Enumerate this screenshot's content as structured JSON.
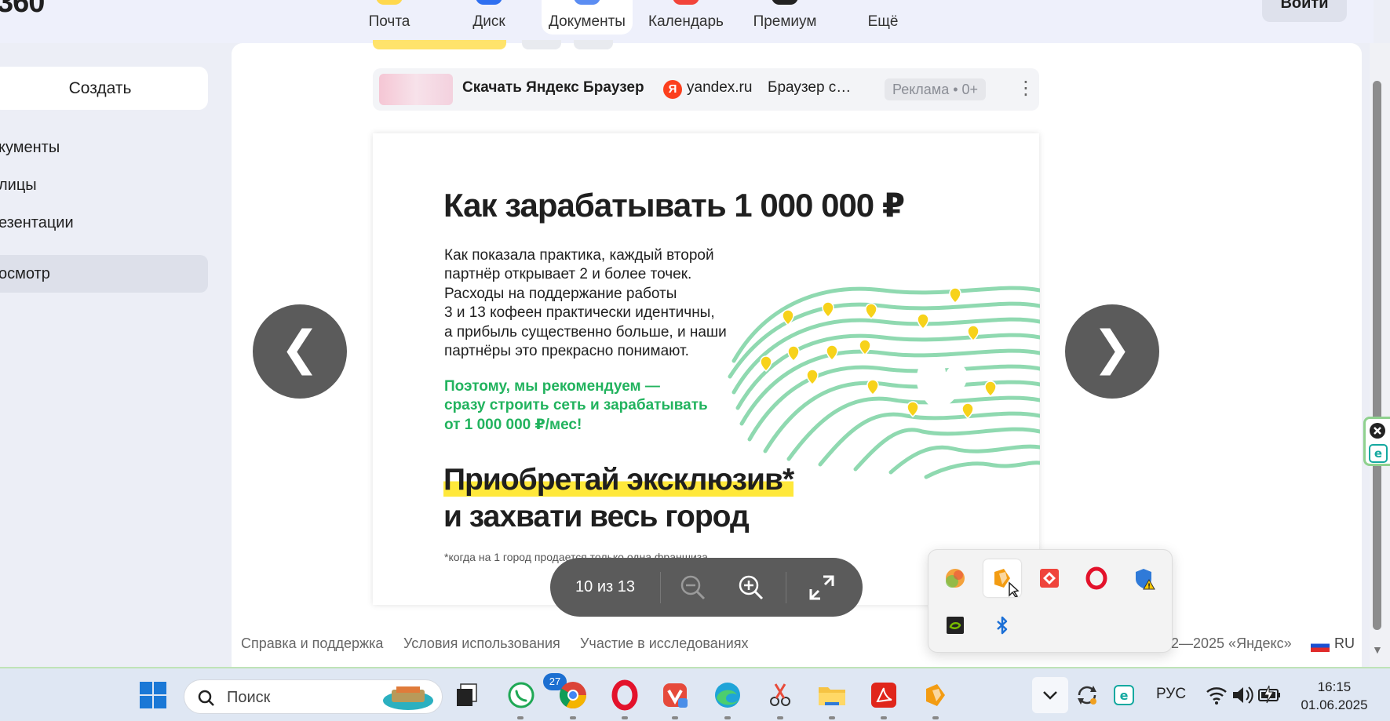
{
  "header": {
    "logo": "360",
    "services": [
      "Почта",
      "Диск",
      "Документы",
      "Календарь",
      "Премиум",
      "Ещё"
    ],
    "active_service": "Документы",
    "login": "Войти"
  },
  "sidebar": {
    "create": "Создать",
    "items": [
      "Документы",
      "Таблицы",
      "Презентации",
      "Просмотр"
    ],
    "items_visible": [
      "кументы",
      "лицы",
      "езентации",
      "осмотр"
    ],
    "active_item": "Просмотр"
  },
  "ad": {
    "title": "Скачать Яндекс Браузер",
    "ya_glyph": "Я",
    "domain": "yandex.ru",
    "desc": "Браузер с…",
    "badge": "Реклама • 0+"
  },
  "slide": {
    "heading": "Как зарабатывать 1 000 000 ₽",
    "body": [
      "Как показала практика, каждый второй",
      "партнёр открывает 2 и более точек.",
      "Расходы на поддержание работы",
      "3 и 13 кофеен практически идентичны,",
      "а прибыль существенно больше, и наши",
      "партнёры это прекрасно понимают."
    ],
    "green": [
      "Поэтому, мы рекомендуем —",
      "сразу строить сеть и зарабатывать",
      "от 1 000 000 ₽/мес!"
    ],
    "big1": "Приобретай эксклюзив*",
    "big2": "и захвати весь город",
    "note": "*когда на 1 город продается только одна франшиза"
  },
  "viewer": {
    "prev": "❮",
    "next": "❯",
    "counter": "10 из 13"
  },
  "footer": {
    "links": [
      "Справка и поддержка",
      "Условия использования",
      "Участие в исследованиях"
    ],
    "copyright": "2—2025 «Яндекс»",
    "lang": "RU"
  },
  "taskbar": {
    "search_placeholder": "Поиск",
    "whatsapp_badge": "27",
    "lang": "РУС",
    "time": "16:15",
    "date": "01.06.2025"
  },
  "colors": {
    "accent_green": "#22b35e",
    "highlight_yellow": "#ffe83b",
    "map_green": "#8fd9b0",
    "pin_yellow": "#f7d21a",
    "nav_gray": "#5b5b5b"
  }
}
